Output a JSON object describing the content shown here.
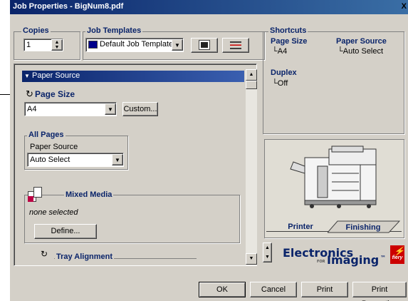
{
  "window": {
    "title": "Job Properties - BigNum8.pdf",
    "close": "X"
  },
  "copies": {
    "label": "Copies",
    "value": "1"
  },
  "job_templates": {
    "label": "Job Templates",
    "selected": "Default Job Templates"
  },
  "shortcuts": {
    "label": "Shortcuts",
    "page_size_label": "Page Size",
    "page_size_value": "A4",
    "paper_source_label": "Paper Source",
    "paper_source_value": "Auto Select",
    "duplex_label": "Duplex",
    "duplex_value": "Off"
  },
  "panel": {
    "header": "Paper Source",
    "page_size_label": "Page Size",
    "page_size_value": "A4",
    "custom_button": "Custom...",
    "all_pages_label": "All Pages",
    "paper_source_label": "Paper Source",
    "paper_source_value": "Auto Select",
    "mixed_media_label": "Mixed Media",
    "mixed_media_status": "none selected",
    "define_button": "Define...",
    "tray_alignment_label": "Tray Alignment"
  },
  "tabs": {
    "printer": "Printer",
    "finishing": "Finishing"
  },
  "brand": {
    "line1": "Electronics",
    "for": "FOR",
    "line2": "Imaging",
    "tm": "™",
    "fiery": "fiery"
  },
  "buttons": {
    "ok": "OK",
    "cancel": "Cancel",
    "print": "Print",
    "print_properties": "Print Properties"
  },
  "colors": {
    "accent": "#0a246a",
    "dialog": "#d4d0c8",
    "brand_red": "#cc0000"
  }
}
